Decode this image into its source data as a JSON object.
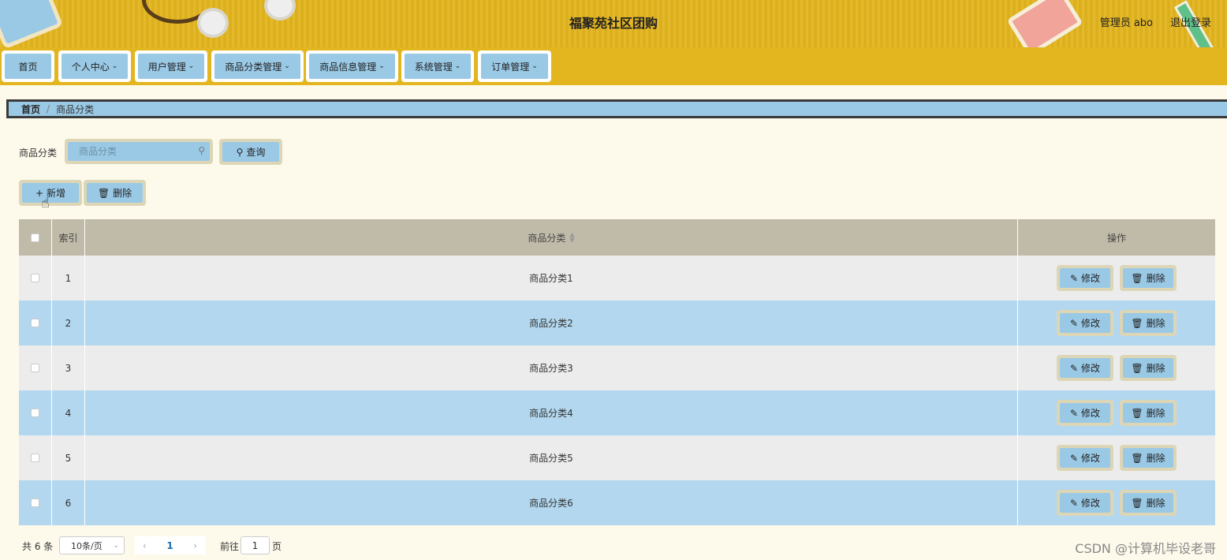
{
  "header": {
    "title": "福聚苑社区团购",
    "user": "管理员 abo",
    "logout": "退出登录"
  },
  "nav": [
    {
      "label": "首页",
      "has_dropdown": false
    },
    {
      "label": "个人中心",
      "has_dropdown": true
    },
    {
      "label": "用户管理",
      "has_dropdown": true
    },
    {
      "label": "商品分类管理",
      "has_dropdown": true
    },
    {
      "label": "商品信息管理",
      "has_dropdown": true
    },
    {
      "label": "系统管理",
      "has_dropdown": true
    },
    {
      "label": "订单管理",
      "has_dropdown": true
    }
  ],
  "breadcrumb": {
    "home": "首页",
    "separator": "/",
    "current": "商品分类"
  },
  "search": {
    "label": "商品分类",
    "placeholder": "商品分类",
    "query_button": "查询"
  },
  "actions": {
    "add": "新增",
    "delete": "删除"
  },
  "table": {
    "columns": {
      "index": "索引",
      "name": "商品分类",
      "operation": "操作"
    },
    "rows": [
      {
        "index": "1",
        "name": "商品分类1"
      },
      {
        "index": "2",
        "name": "商品分类2"
      },
      {
        "index": "3",
        "name": "商品分类3"
      },
      {
        "index": "4",
        "name": "商品分类4"
      },
      {
        "index": "5",
        "name": "商品分类5"
      },
      {
        "index": "6",
        "name": "商品分类6"
      }
    ],
    "row_actions": {
      "edit": "修改",
      "delete": "删除"
    }
  },
  "pager": {
    "total": "共 6 条",
    "page_size": "10条/页",
    "current_page": "1",
    "goto_label": "前往",
    "goto_value": "1",
    "page_suffix": "页"
  },
  "watermark": "CSDN @计算机毕设老哥",
  "colors": {
    "header_bg": "#e3b51f",
    "button_bg": "#9ac9e6",
    "button_border": "#ddd6b6",
    "row_even": "#b2d7ee",
    "row_odd": "#ececec",
    "table_head": "#c0baa8"
  }
}
